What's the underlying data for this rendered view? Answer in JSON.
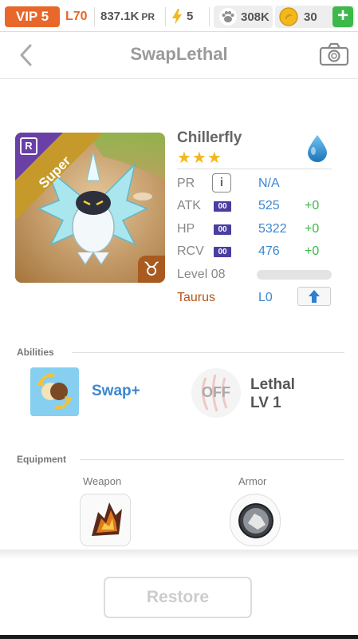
{
  "status": {
    "vip": "VIP 5",
    "level": "L70",
    "power": "837.1K",
    "power_unit": "PR",
    "stamina": "5",
    "paws": "308K",
    "coins": "30",
    "plus": "+"
  },
  "header": {
    "title": "SwapLethal"
  },
  "monster": {
    "name": "Chillerfly",
    "stars": "★★★",
    "rarity": "Super",
    "card_tag": "R",
    "zodiac_symbol": "♉",
    "element_icon": "water-drop-icon",
    "stats": [
      {
        "label": "PR",
        "value": "N/A",
        "bonus": ""
      },
      {
        "label": "ATK",
        "badge": "00",
        "value": "525",
        "bonus": "+0"
      },
      {
        "label": "HP",
        "badge": "00",
        "value": "5322",
        "bonus": "+0"
      },
      {
        "label": "RCV",
        "badge": "00",
        "value": "476",
        "bonus": "+0"
      }
    ],
    "info_badge": "i",
    "level_label": "Level 08",
    "level_progress": 0,
    "zodiac": "Taurus",
    "zodiac_level": "L0"
  },
  "abilities": {
    "section_title": "Abilities",
    "items": [
      {
        "name": "Swap+"
      },
      {
        "state": "OFF",
        "name": "Lethal",
        "level": "LV 1"
      }
    ]
  },
  "equipment": {
    "section_title": "Equipment",
    "slots": [
      {
        "label": "Weapon"
      },
      {
        "label": "Armor"
      }
    ]
  },
  "footer": {
    "restore": "Restore"
  },
  "colors": {
    "accent": "#3d87cf",
    "vip": "#e8672a",
    "green": "#3cb94a",
    "star": "#f2b81d"
  }
}
